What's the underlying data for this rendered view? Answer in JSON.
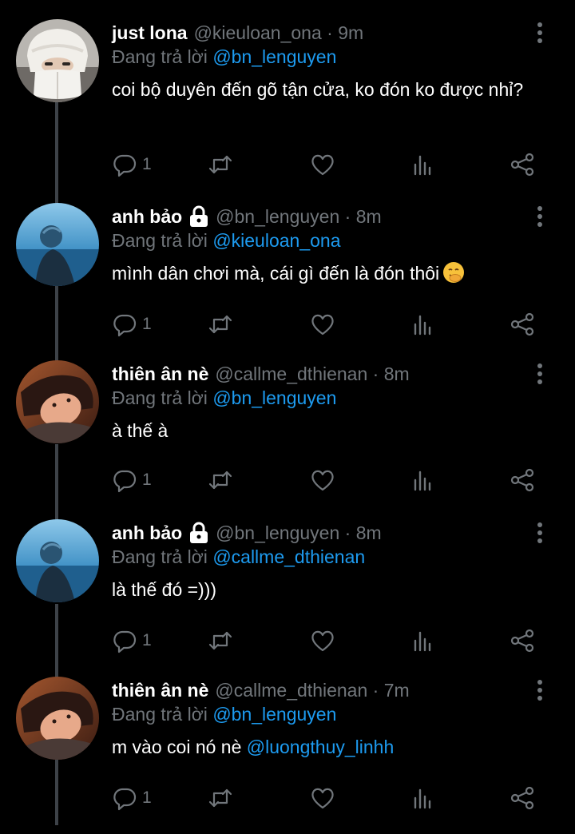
{
  "reply_prefix": "Đang trả lời",
  "colors": {
    "background": "#000000",
    "accent": "#1d9bf0",
    "muted": "#71767b",
    "text": "#ffffff"
  },
  "icons": [
    "more-vertical-icon",
    "reply-icon",
    "retweet-icon",
    "like-icon",
    "analytics-icon",
    "share-icon",
    "lock-icon",
    "hand-over-mouth-emoji"
  ],
  "tweets": [
    {
      "name": "just lona",
      "locked": false,
      "handle": "@kieuloan_ona",
      "time": "9m",
      "reply_to": "@bn_lenguyen",
      "text": "coi bộ duyên đến gõ tận cửa, ko đón ko được nhỉ?",
      "text_mention": "",
      "emoji": false,
      "reply_count": "1",
      "avatar": "white-fur-hat"
    },
    {
      "name": "anh bảo",
      "locked": true,
      "handle": "@bn_lenguyen",
      "time": "8m",
      "reply_to": "@kieuloan_ona",
      "text": "mình dân chơi mà, cái gì đến là đón thôi",
      "text_mention": "",
      "emoji": true,
      "reply_count": "1",
      "avatar": "blue-sea"
    },
    {
      "name": "thiên ân nè",
      "locked": false,
      "handle": "@callme_dthienan",
      "time": "8m",
      "reply_to": "@bn_lenguyen",
      "text": "à thế à",
      "text_mention": "",
      "emoji": false,
      "reply_count": "1",
      "avatar": "warm-portrait"
    },
    {
      "name": "anh bảo",
      "locked": true,
      "handle": "@bn_lenguyen",
      "time": "8m",
      "reply_to": "@callme_dthienan",
      "text": "là thế đó =)))",
      "text_mention": "",
      "emoji": false,
      "reply_count": "1",
      "avatar": "blue-sea"
    },
    {
      "name": "thiên ân nè",
      "locked": false,
      "handle": "@callme_dthienan",
      "time": "7m",
      "reply_to": "@bn_lenguyen",
      "text": "m vào coi nó nè ",
      "text_mention": "@luongthuy_linhh",
      "emoji": false,
      "reply_count": "1",
      "avatar": "warm-portrait"
    }
  ]
}
